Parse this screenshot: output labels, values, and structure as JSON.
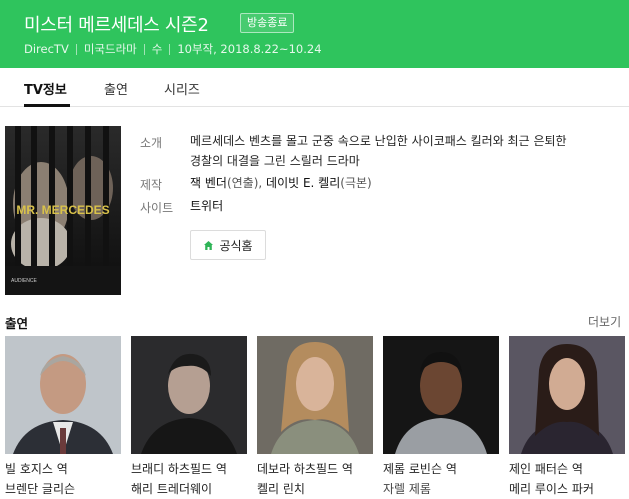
{
  "header": {
    "title": "미스터 메르세데스 시즌2",
    "badge": "방송종료",
    "channel": "DirecTV",
    "genre": "미국드라마",
    "day": "수",
    "episodes_dates": "10부작, 2018.8.22~10.24",
    "bg_color": "#2fc45d"
  },
  "tabs": [
    {
      "label": "TV정보",
      "active": true
    },
    {
      "label": "출연",
      "active": false
    },
    {
      "label": "시리즈",
      "active": false
    }
  ],
  "poster": {
    "title_text": "MR. MERCEDES",
    "corner_text": "AUDIENCE"
  },
  "info": {
    "synopsis_key": "소개",
    "synopsis_line1": "메르세데스 벤츠를 몰고 군중 속으로 난입한 사이코패스 킬러와 최근 은퇴한",
    "synopsis_line2": "경찰의 대결을 그린 스릴러 드라마",
    "production_key": "제작",
    "director_name": "잭 벤더",
    "director_role": "(연출)",
    "writer_name": "데이빗 E. 켈리",
    "writer_role": "(극본)",
    "site_key": "사이트",
    "site_value": "트위터",
    "home_button": "공식홈"
  },
  "cast_section": {
    "title": "출연",
    "more": "더보기"
  },
  "cast": [
    {
      "role": "빌 호지스 역",
      "name": "브렌단 글리슨"
    },
    {
      "role": "브래디 하츠필드 역",
      "name": "해리 트레더웨이"
    },
    {
      "role": "데보라 하츠필드 역",
      "name": "켈리 린치"
    },
    {
      "role": "제롬 로빈슨 역",
      "name": "자렐 제롬"
    },
    {
      "role": "제인 패터슨 역",
      "name": "메리 루이스 파커"
    }
  ]
}
